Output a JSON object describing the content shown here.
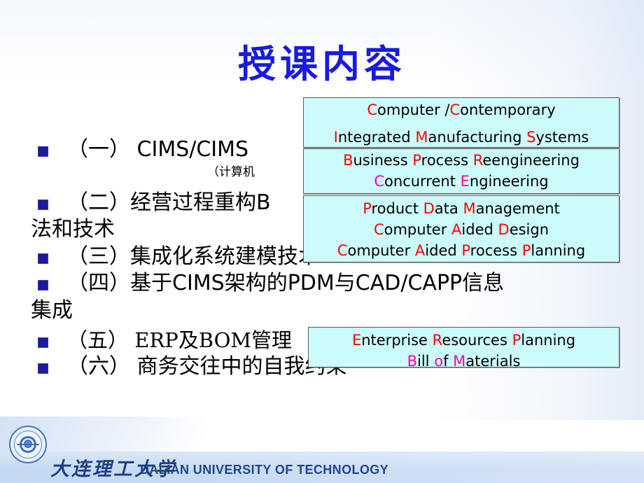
{
  "slide": {
    "title": "授课内容",
    "title_color": "#1a1ae0",
    "background_color": "#ffffff",
    "callout_fill": "#ccfbfb",
    "accent_red": "#ff0000",
    "accent_magenta": "#ff00a0",
    "bullet_marker_color": "#1b1b96"
  },
  "bullets": [
    {
      "num": "（一）",
      "text": "CIMS/CIMS",
      "note": "（计算机"
    },
    {
      "num": "（二）",
      "text": "经营过程重构B"
    },
    {
      "num": "",
      "text": "法和技术"
    },
    {
      "num": "（三）",
      "text": "集成化系统建模技术"
    },
    {
      "num": "（四）",
      "text": "基于CIMS架构的PDM与CAD/CAPP信息"
    },
    {
      "num": "",
      "text": "集成"
    },
    {
      "num": "（五）",
      "text": "ERP及BOM管理"
    },
    {
      "num": "（六）",
      "text": "商务交往中的自我约束"
    }
  ],
  "bullet_lines": {
    "b1_full": "（一）   CIMS/CIMS",
    "b1_note": "（计算机",
    "b2_l1": "（二）经营过程重构B",
    "b2_l2": "法和技术",
    "b3": "（三）集成化系统建模技术",
    "b4_l1": "（四）基于CIMS架构的PDM与CAD/CAPP信息",
    "b4_l2": "集成",
    "b5": "（五）   ERP及BOM管理",
    "b6": "（六）   商务交往中的自我约束"
  },
  "callouts": {
    "cims": {
      "line1_cap1": "C",
      "line1_mid": "omputer /",
      "line1_cap2": "C",
      "line1_tail": "ontemporary",
      "line2_cap1": "I",
      "line2_a": "ntegrated ",
      "line2_cap2": "M",
      "line2_b": "anufacturing ",
      "line2_cap3": "S",
      "line2_c": "ystems"
    },
    "bpr": {
      "line1_cap1": "B",
      "line1_a": "usiness ",
      "line1_cap2": "P",
      "line1_b": "rocess ",
      "line1_cap3": "R",
      "line1_c": "eengineering",
      "line2_cap1": "C",
      "line2_a": "oncurrent ",
      "line2_cap2": "E",
      "line2_b": "ngineering"
    },
    "pdm": {
      "line1_cap1": "P",
      "line1_a": "roduct ",
      "line1_cap2": "D",
      "line1_b": "ata  ",
      "line1_cap3": "M",
      "line1_c": "anagement",
      "line2_cap1": "C",
      "line2_a": "omputer ",
      "line2_cap2": "A",
      "line2_b": "ided ",
      "line2_cap3": "D",
      "line2_c": "esign",
      "line3_cap1": "C",
      "line3_a": "omputer ",
      "line3_cap2": "A",
      "line3_b": "ided ",
      "line3_cap3": "P",
      "line3_c": "rocess ",
      "line3_cap4": "P",
      "line3_d": "lanning"
    },
    "erp": {
      "line1_cap1": "E",
      "line1_a": "nterprise ",
      "line1_cap2": "R",
      "line1_b": "esources ",
      "line1_cap3": "P",
      "line1_c": "lanning",
      "line2_cap1": "B",
      "line2_a": "ill ",
      "line2_cap2": "o",
      "line2_b": "f ",
      "line2_cap3": "M",
      "line2_c": "aterials"
    }
  },
  "footer": {
    "university_cn": "大连理工大学",
    "university_en": "DALIAN UNIVERSITY OF TECHNOLOGY"
  }
}
